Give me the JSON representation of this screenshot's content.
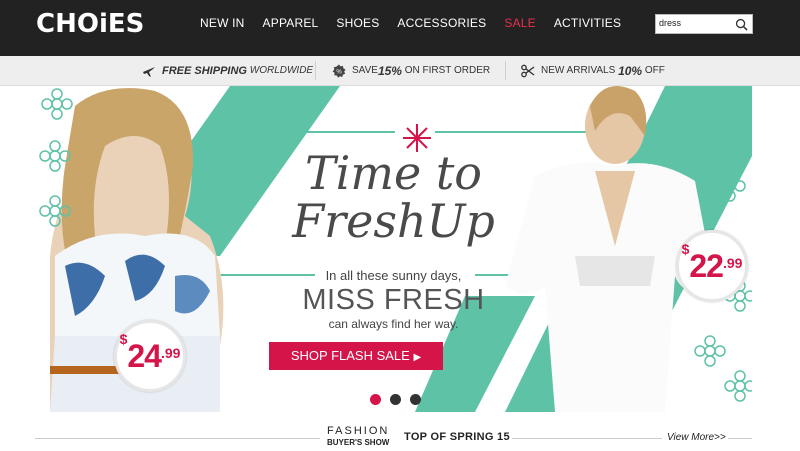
{
  "header": {
    "logo": "CHOiES",
    "nav": [
      "NEW IN",
      "APPAREL",
      "SHOES",
      "ACCESSORIES",
      "SALE",
      "ACTIVITIES"
    ],
    "search_value": "dress",
    "accent_sale": "#e8314f",
    "background": "#222222"
  },
  "promos": {
    "shipping_bold": "FREE SHIPPING",
    "shipping_rest": "WORLDWIDE",
    "save_pre": "SAVE",
    "save_pct": "15%",
    "save_post": "ON FIRST ORDER",
    "arrivals_pre": "NEW ARRIVALS",
    "arrivals_pct": "10%",
    "arrivals_post": "OFF",
    "icons": [
      "plane-icon",
      "percent-badge-icon",
      "scissors-icon"
    ]
  },
  "banner": {
    "headline_line1": "Time to",
    "headline_line2": "FreshUp",
    "sub1": "In all these sunny days,",
    "miss": "MISS FRESH",
    "sub2": "can always find her way.",
    "cta": "SHOP FLASH SALE",
    "price_left": {
      "cur": "$",
      "int": "24",
      "dec": ".99"
    },
    "price_right": {
      "cur": "$",
      "int": "22",
      "dec": ".99"
    },
    "accent_color": "#5ec2a7",
    "cta_color": "#d5154a",
    "slides": 3,
    "active_slide": 1
  },
  "section": {
    "fashion": "FASHION",
    "buyers": "BUYER'S SHOW",
    "title": "TOP OF SPRING 15",
    "view_more": "View More>>"
  }
}
